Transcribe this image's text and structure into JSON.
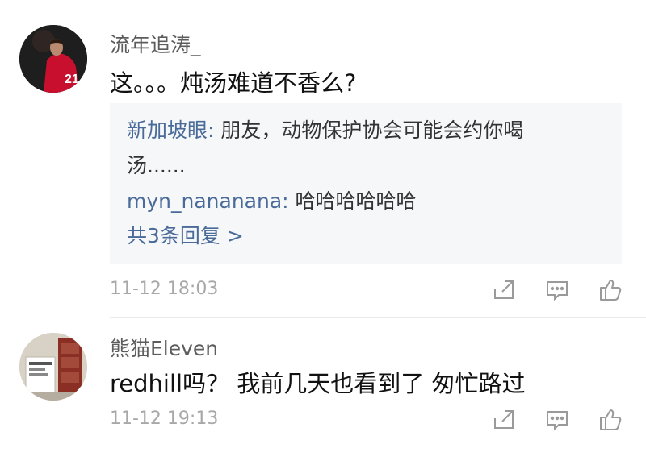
{
  "comments": [
    {
      "username": "流年追涛_",
      "text": "这。。。炖汤难道不香么?",
      "replies": [
        {
          "name": "新加坡眼",
          "sep": ": ",
          "text": "朋友，动物保护协会可能会约你喝汤......"
        },
        {
          "name": "myn_nananana",
          "sep": ": ",
          "text": "哈哈哈哈哈哈"
        }
      ],
      "more_replies": "共3条回复 >",
      "time": "11-12 18:03"
    },
    {
      "username": "熊猫Eleven",
      "text": "redhill吗？ 我前几天也看到了 匆忙路过",
      "time": "11-12 19:13"
    }
  ],
  "icons": [
    "share-icon",
    "reply-icon",
    "like-icon"
  ],
  "colors": {
    "link": "#4a6a99",
    "meta": "#a8a8a8",
    "reply_bg": "#f6f7f9"
  }
}
